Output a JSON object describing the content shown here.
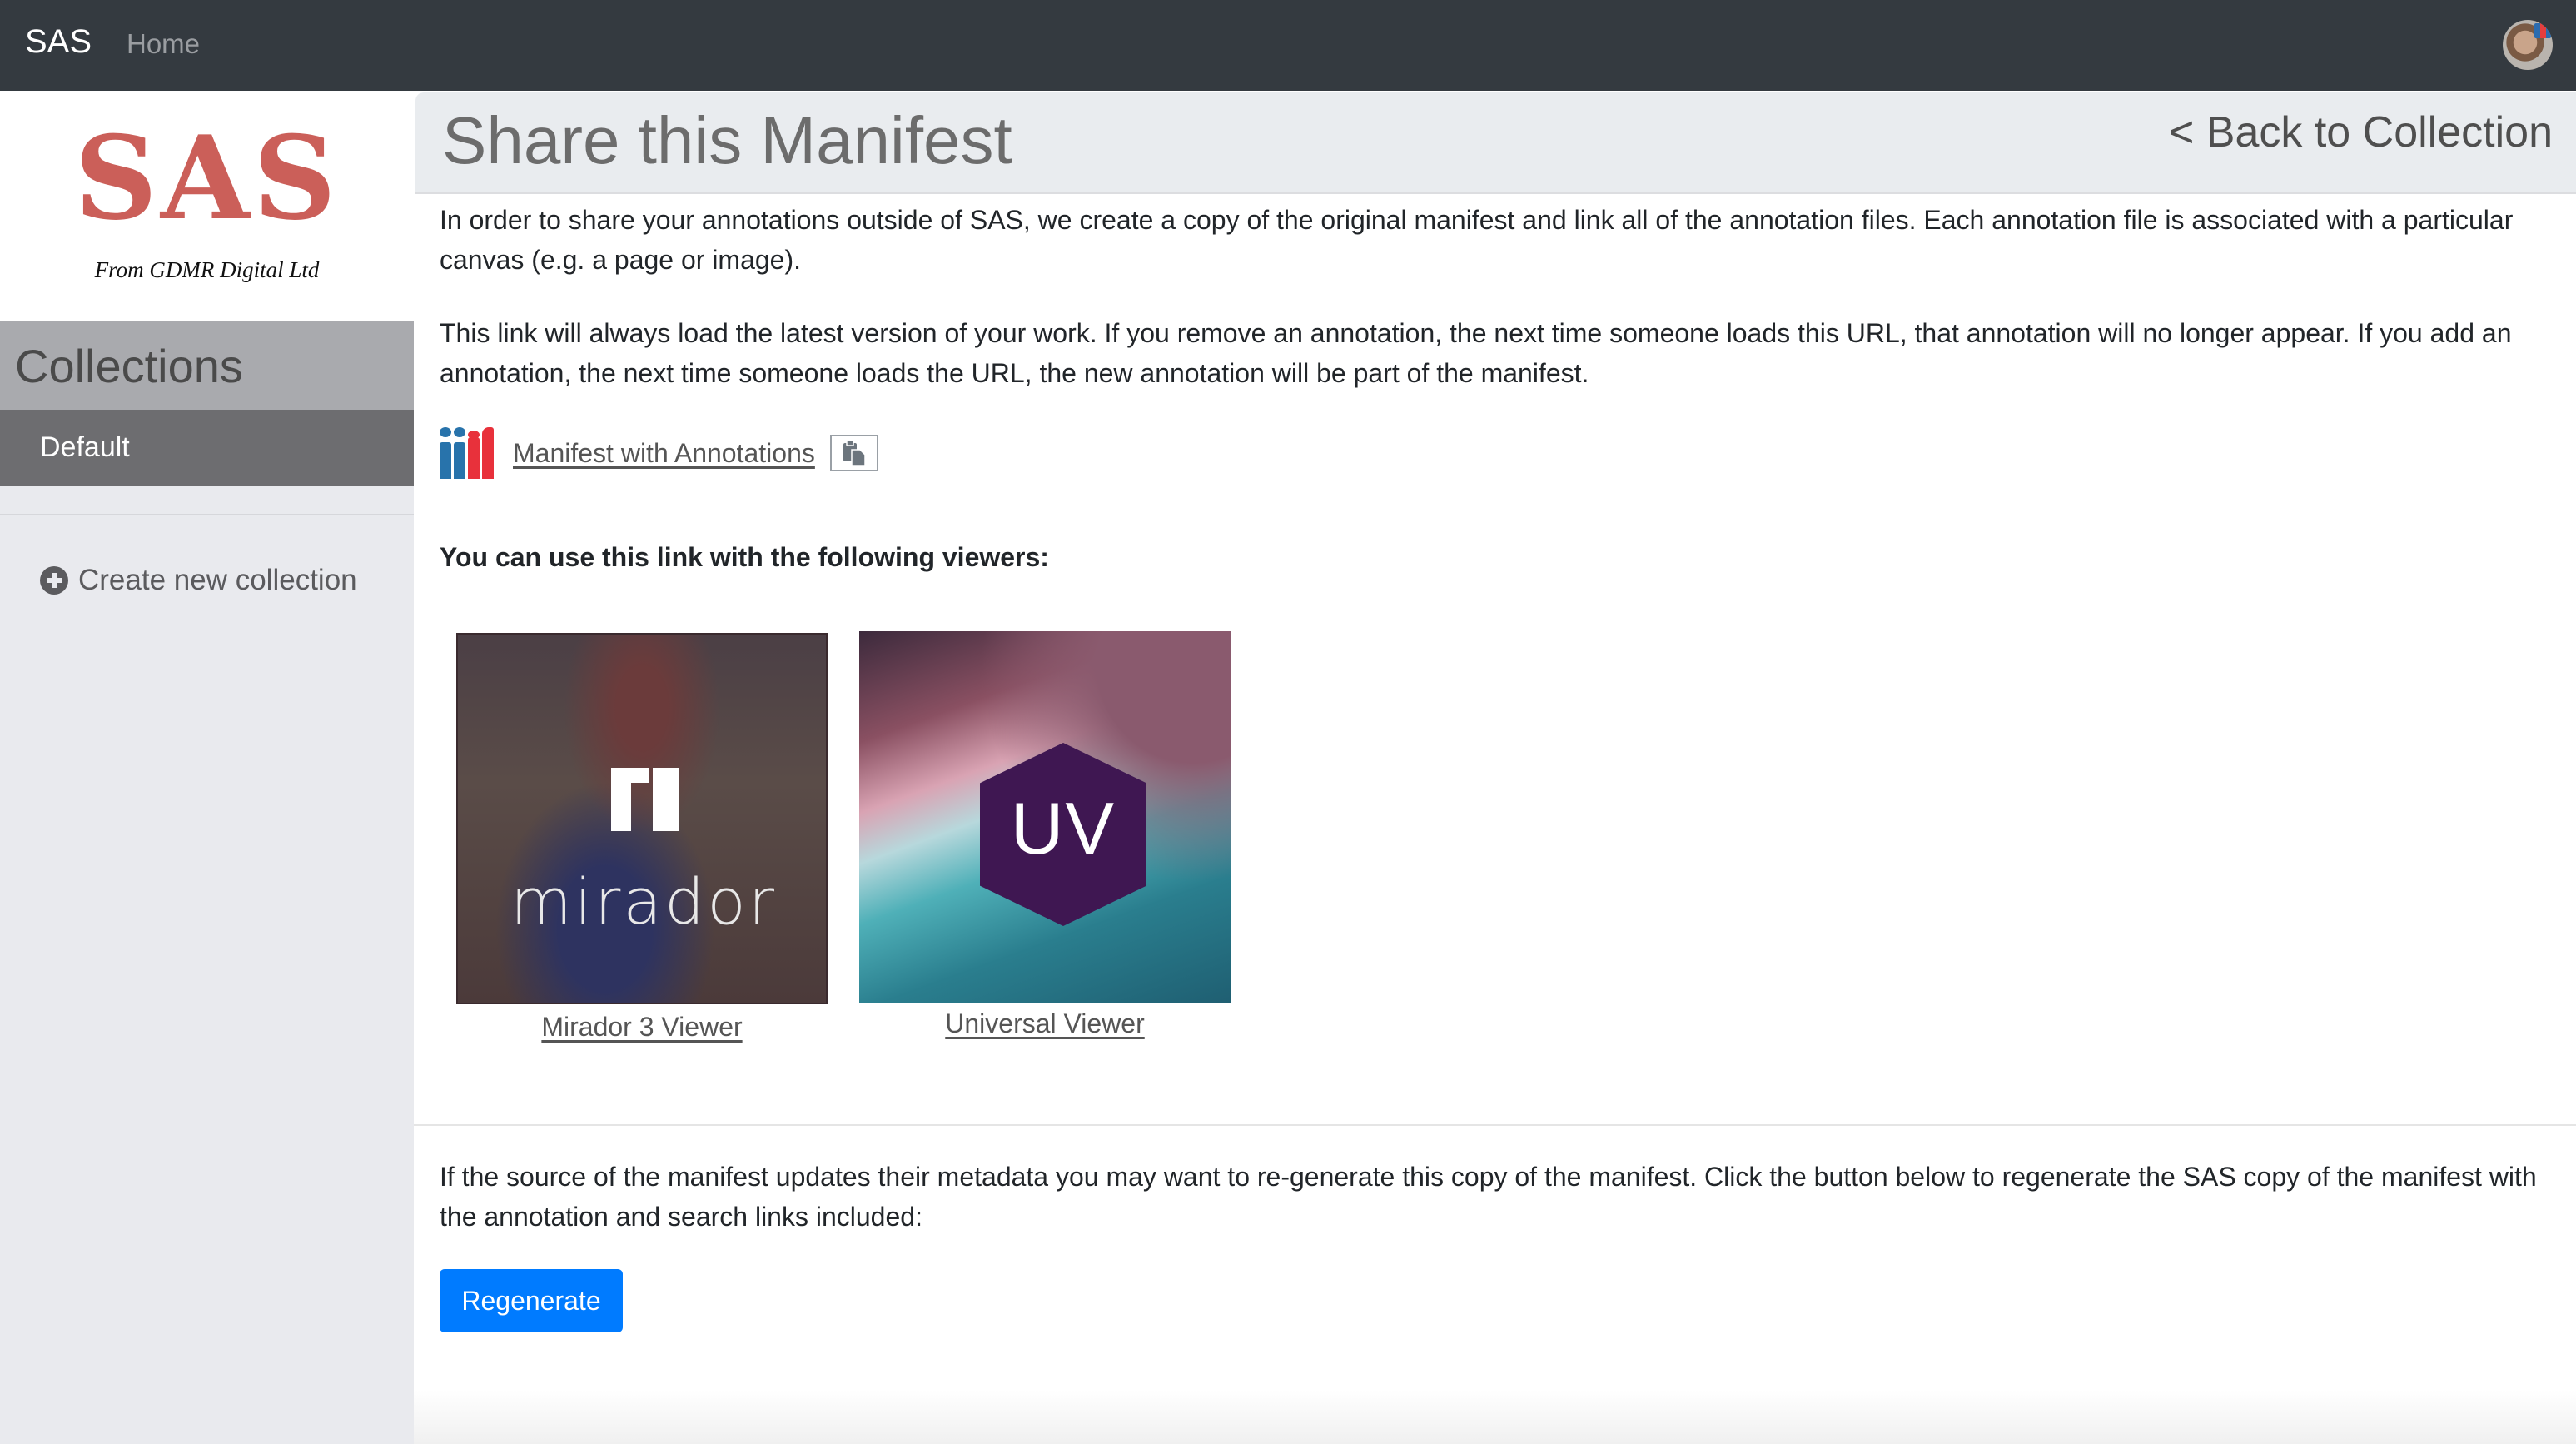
{
  "navbar": {
    "brand": "SAS",
    "home_label": "Home",
    "avatar_icon": "user-avatar"
  },
  "sidebar": {
    "logo_title": "SAS",
    "logo_subtitle": "From GDMR Digital Ltd",
    "collections_heading": "Collections",
    "collections": [
      {
        "label": "Default",
        "active": true
      }
    ],
    "create_label": "Create new collection",
    "create_icon": "plus-circle-icon"
  },
  "main": {
    "title": "Share this Manifest",
    "back_label": "< Back to Collection",
    "paragraph1": "In order to share your annotations outside of SAS, we create a copy of the original manifest and link all of the annotation files. Each annotation file is associated with a particular canvas (e.g. a page or image).",
    "paragraph2": "This link will always load the latest version of your work. If you remove an annotation, the next time someone loads this URL, that annotation will no longer appear. If you add an annotation, the next time someone loads the URL, the new annotation will be part of the manifest.",
    "manifest_link_label": "Manifest with Annotations",
    "manifest_icon": "iiif-logo",
    "copy_icon": "clipboard-copy-icon",
    "viewers_heading": "You can use this link with the following viewers:",
    "viewers": [
      {
        "name": "Mirador 3 Viewer",
        "logo_text": "mirador"
      },
      {
        "name": "Universal Viewer",
        "logo_text": "UV"
      }
    ],
    "paragraph3": "If the source of the manifest updates their metadata you may want to re-generate this copy of the manifest. Click the button below to regenerate the SAS copy of the manifest with the annotation and search links included:",
    "regenerate_label": "Regenerate"
  },
  "colors": {
    "navbar_bg": "#343a40",
    "logo_red": "#cb5f59",
    "primary_button": "#007bff",
    "sidebar_active": "#6d6d70",
    "sidebar_header": "#a9aaae",
    "uv_hex": "#3f1752"
  }
}
